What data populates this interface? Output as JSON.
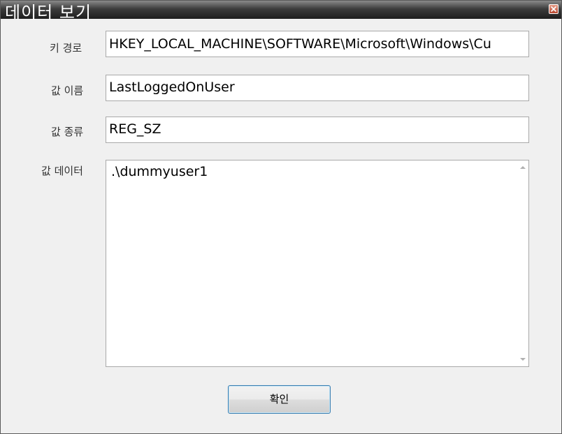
{
  "window": {
    "title": "데이터 보기"
  },
  "fields": {
    "key_path": {
      "label": "키 경로",
      "value": "HKEY_LOCAL_MACHINE\\SOFTWARE\\Microsoft\\Windows\\Cu"
    },
    "value_name": {
      "label": "값 이름",
      "value": "LastLoggedOnUser"
    },
    "value_type": {
      "label": "값 종류",
      "value": "REG_SZ"
    },
    "value_data": {
      "label": "값 데이터",
      "value": ".\\dummyuser1"
    }
  },
  "buttons": {
    "ok_label": "확인"
  },
  "icons": {
    "close": "close-icon",
    "scroll_up": "scroll-up-arrow-icon",
    "scroll_down": "scroll-down-arrow-icon"
  },
  "colors": {
    "titlebar_dark": "#1e1e1e",
    "close_button": "#b8462e",
    "button_border": "#3c7fb1"
  }
}
